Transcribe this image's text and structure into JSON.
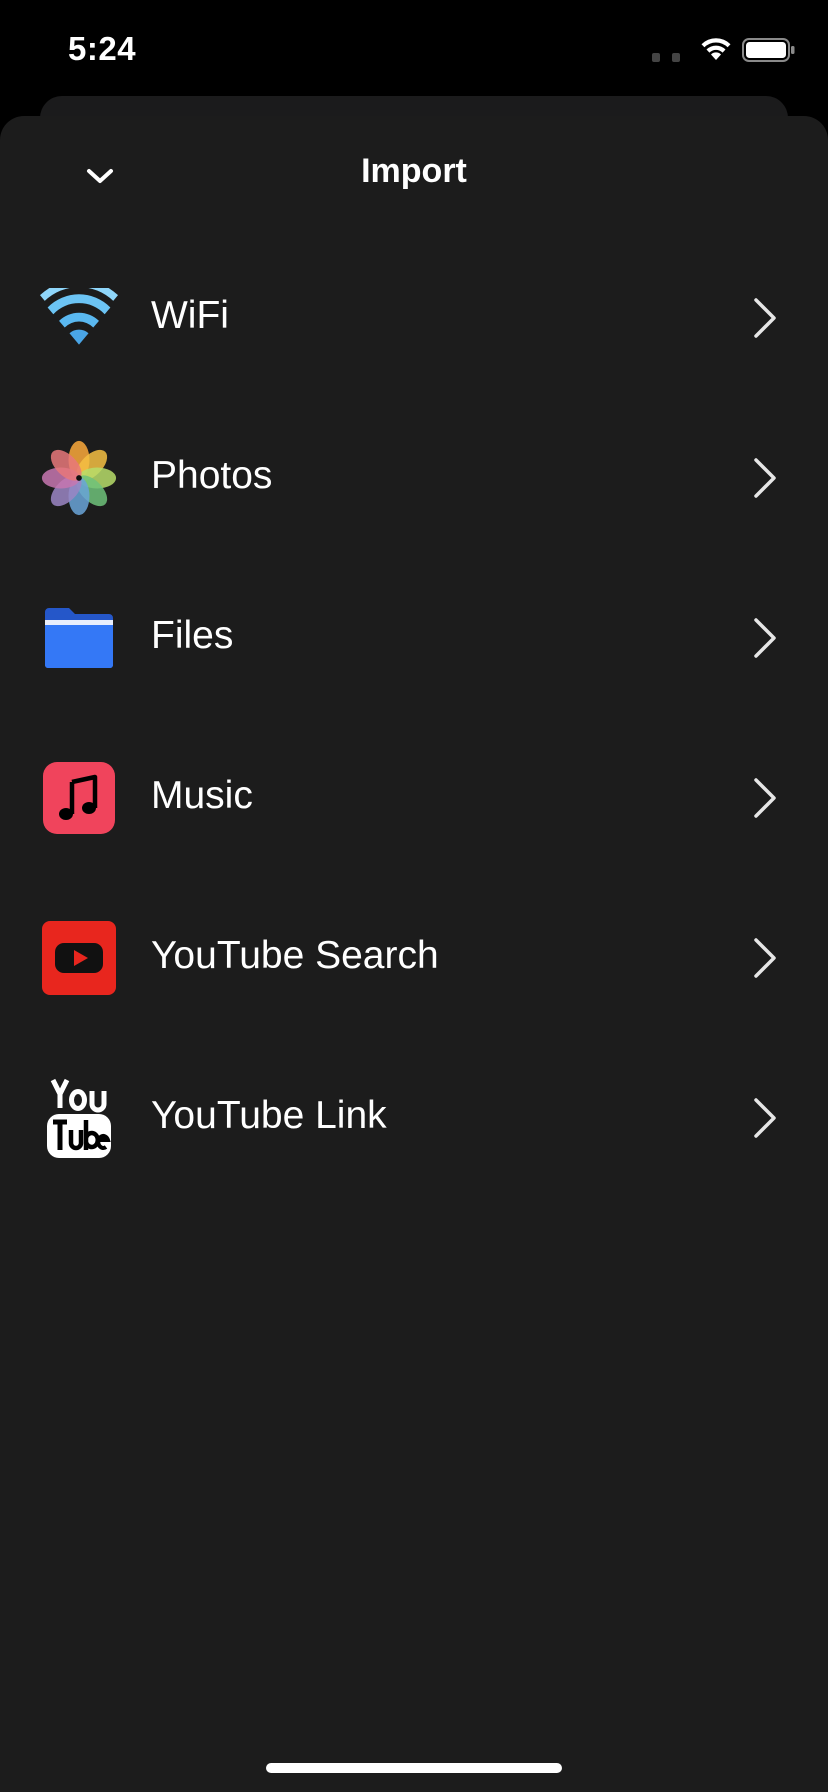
{
  "status_bar": {
    "time": "5:24",
    "wifi_icon": "wifi-icon",
    "battery_icon": "battery-icon"
  },
  "nav": {
    "title": "Import",
    "dismiss_icon": "chevron-down-icon"
  },
  "items": [
    {
      "label": "WiFi",
      "icon": "wifi-icon",
      "color": "#5ab8f0"
    },
    {
      "label": "Photos",
      "icon": "photos-icon",
      "color": "#f4a23c"
    },
    {
      "label": "Files",
      "icon": "folder-icon",
      "color": "#3478f6"
    },
    {
      "label": "Music",
      "icon": "music-note-icon",
      "color": "#f0445c"
    },
    {
      "label": "YouTube Search",
      "icon": "youtube-play-icon",
      "color": "#e8261e"
    },
    {
      "label": "YouTube Link",
      "icon": "youtube-logo-icon",
      "color": "#ffffff"
    }
  ],
  "theme": {
    "background": "#1c1c1c",
    "text": "#ffffff",
    "chevron": "#e6e6e6"
  }
}
